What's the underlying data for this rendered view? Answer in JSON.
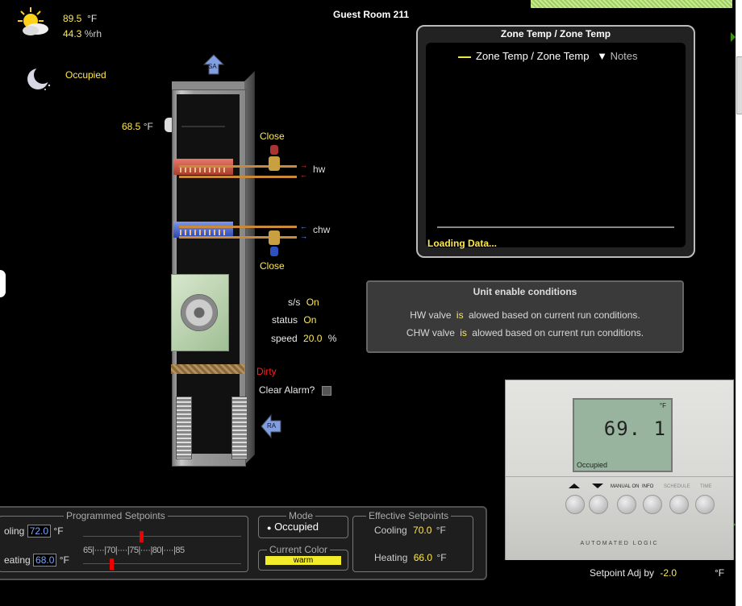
{
  "title": "Guest Room 211",
  "weather": {
    "temp": "89.5",
    "temp_unit": "°F",
    "rh": "44.3",
    "rh_unit": "%rh"
  },
  "occupancy": "Occupied",
  "ahu": {
    "supply_tag": "SA",
    "return_tag": "RA",
    "space_temp": "68.5",
    "space_temp_unit": "°F",
    "hw_valve": "Close",
    "hw_label": "hw",
    "chw_valve": "Close",
    "chw_label": "chw",
    "fan": {
      "ss_label": "s/s",
      "ss_value": "On",
      "status_label": "status",
      "status_value": "On",
      "speed_label": "speed",
      "speed_value": "20.0",
      "speed_unit": "%"
    },
    "filter_status": "Dirty",
    "clear_alarm_label": "Clear Alarm?"
  },
  "trend": {
    "title": "Zone Temp / Zone Temp",
    "legend": "Zone Temp / Zone Temp",
    "notes": "Notes",
    "loading": "Loading Data...",
    "series_color": "#f3e640"
  },
  "enable_conditions": {
    "title": "Unit enable conditions",
    "rows": [
      {
        "prefix": "HW valve",
        "state": "is",
        "suffix": "alowed based on current run conditions."
      },
      {
        "prefix": "CHW valve",
        "state": "is",
        "suffix": "alowed based on current run conditions."
      }
    ]
  },
  "programmed": {
    "legend": "Programmed Setpoints",
    "cooling_label": "oling",
    "cooling_value": "72.0",
    "heating_label": "eating",
    "heating_value": "68.0",
    "unit": "°F",
    "scale": "65|····|70|····|75|····|80|····|85"
  },
  "mode": {
    "legend": "Mode",
    "value": "Occupied"
  },
  "current_color": {
    "legend": "Current Color",
    "value": "warm",
    "color": "#f3ec2a"
  },
  "effective": {
    "legend": "Effective Setpoints",
    "cooling_label": "Cooling",
    "cooling_value": "70.0",
    "heating_label": "Heating",
    "heating_value": "66.0",
    "unit": "°F"
  },
  "thermostat": {
    "reading": "69. 1",
    "unit": "°F",
    "status": "Occupied",
    "buttons": [
      "MANUAL ON",
      "INFO",
      "SCHEDULE",
      "TIME"
    ],
    "brand": "AUTOMATED LOGIC"
  },
  "setpoint_adj": {
    "label": "Setpoint Adj by",
    "value": "-2.0",
    "unit": "°F"
  }
}
